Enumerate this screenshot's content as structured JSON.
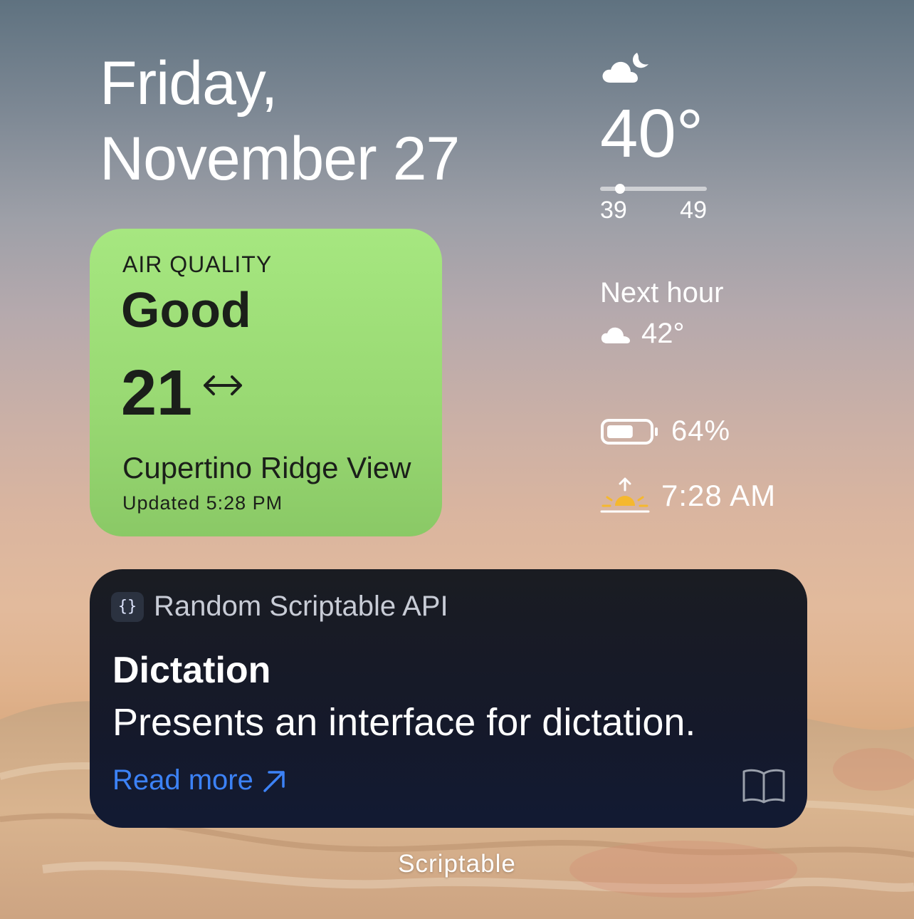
{
  "date": {
    "line1": "Friday,",
    "line2": "November 27"
  },
  "weather": {
    "condition_icon": "cloud-moon-icon",
    "temperature": "40°",
    "low": "39",
    "high": "49",
    "current_position_fraction": 0.15,
    "next_hour_label": "Next hour",
    "next_hour_icon": "cloud-icon",
    "next_hour_temp": "42°"
  },
  "battery": {
    "icon": "battery-icon",
    "percent_label": "64%",
    "level": 0.64
  },
  "sunrise": {
    "icon": "sunrise-icon",
    "time": "7:28 AM"
  },
  "air_quality": {
    "label": "AIR QUALITY",
    "status": "Good",
    "value": "21",
    "trend_icon": "left-right-arrow-icon",
    "location": "Cupertino Ridge View",
    "updated": "Updated 5:28 PM",
    "color": "#9fe07a"
  },
  "api_widget": {
    "badge": "{}",
    "header_title": "Random Scriptable API",
    "name": "Dictation",
    "description": "Presents an interface for dictation.",
    "link_label": "Read more",
    "link_color": "#3c82f6"
  },
  "app_label": "Scriptable"
}
